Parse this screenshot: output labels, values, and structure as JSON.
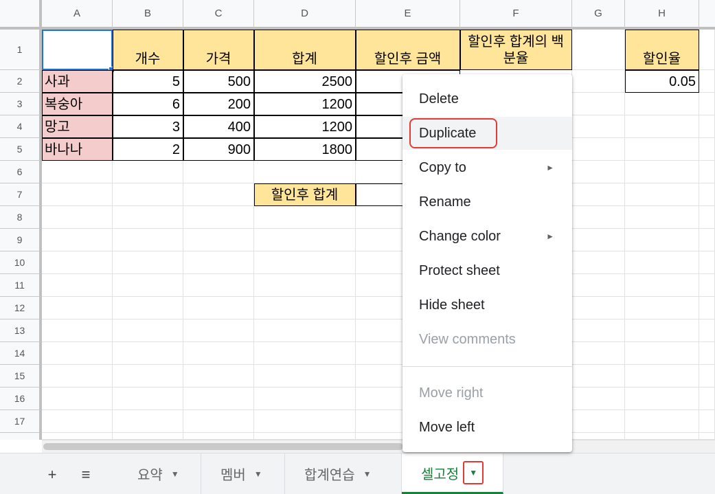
{
  "columns": [
    "A",
    "B",
    "C",
    "D",
    "E",
    "F",
    "G",
    "H"
  ],
  "rows": [
    "1",
    "2",
    "3",
    "4",
    "5",
    "6",
    "7",
    "8",
    "9",
    "10",
    "11",
    "12",
    "13",
    "14",
    "15",
    "16",
    "17"
  ],
  "header_row": {
    "b": "개수",
    "c": "가격",
    "d": "합계",
    "e": "할인후 금액",
    "f": "할인후 합계의 백분율",
    "h": "할인율"
  },
  "data_rows": [
    {
      "fruit": "사과",
      "qty": "5",
      "price": "500",
      "total": "2500"
    },
    {
      "fruit": "복숭아",
      "qty": "6",
      "price": "200",
      "total": "1200"
    },
    {
      "fruit": "망고",
      "qty": "3",
      "price": "400",
      "total": "1200"
    },
    {
      "fruit": "바나나",
      "qty": "2",
      "price": "900",
      "total": "1800"
    }
  ],
  "discount_rate": "0.05",
  "after_total_label": "할인후 합계",
  "context_menu": {
    "items": [
      {
        "label": "Delete"
      },
      {
        "label": "Duplicate"
      },
      {
        "label": "Copy to"
      },
      {
        "label": "Rename"
      },
      {
        "label": "Change color"
      },
      {
        "label": "Protect sheet"
      },
      {
        "label": "Hide sheet"
      },
      {
        "label": "View comments"
      },
      {
        "label": "Move right"
      },
      {
        "label": "Move left"
      }
    ]
  },
  "tabs": [
    {
      "label": "요약"
    },
    {
      "label": "멤버"
    },
    {
      "label": "합계연습"
    },
    {
      "label": "셀고정"
    }
  ],
  "icons": {
    "add": "+",
    "list": "≡",
    "dropdown": "▼",
    "submenu": "►"
  },
  "colors": {
    "header_yellow": "#ffe599",
    "fruit_pink": "#f4cccc",
    "active_tab_green": "#188038",
    "highlight_red": "#e53935",
    "selection_blue": "#1a73e8"
  }
}
